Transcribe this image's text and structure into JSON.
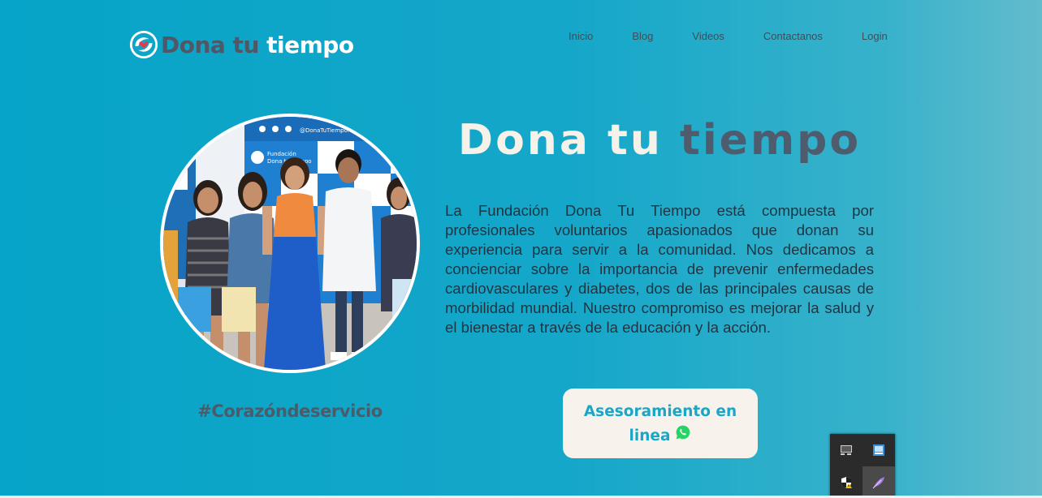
{
  "header": {
    "logo_dark": "Dona tu",
    "logo_light": "tiempo",
    "nav": [
      "Inicio",
      "Blog",
      "Videos",
      "Contactanos",
      "Login"
    ]
  },
  "hero": {
    "title_light": "Dona tu",
    "title_dark": "tiempo",
    "description": "La Fundación Dona Tu Tiempo está compuesta por profesionales voluntarios apasionados que donan su experiencia para servir a la comunidad. Nos dedicamos a concienciar sobre la importancia de prevenir enfermedades cardiovasculares y diabetes, dos de las principales causas de morbilidad mundial. Nuestro compromiso es mejorar la salud y el bienestar a través de la educación y la acción.",
    "hashtag": "#Corazóndeservicio",
    "cta_line1": "Asesoramiento en",
    "cta_line2": "linea"
  },
  "photo": {
    "banner_handle": "@DonaTuTiempo.Org",
    "banner_line1": "Fundación",
    "banner_line2": "Dona tu tiempo"
  },
  "tray": {
    "icons": [
      "monitor-icon",
      "network-app-icon",
      "security-shield-warning-icon",
      "feather-app-icon"
    ]
  },
  "colors": {
    "background": "#06a4c8",
    "accent_dark": "#4e5c6d",
    "cta_bg": "#f7f3ec",
    "cta_text": "#1aa6c6",
    "whatsapp": "#25d366"
  }
}
